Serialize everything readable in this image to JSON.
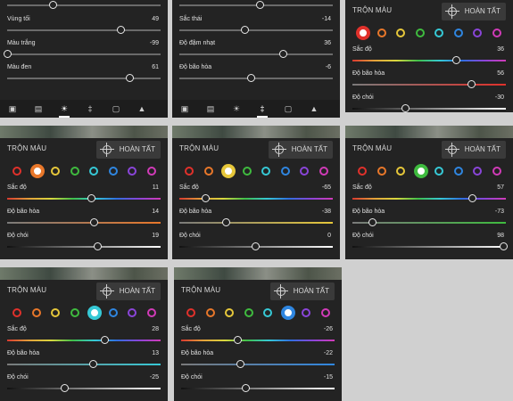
{
  "colors": {
    "red": "#e0312b",
    "orange": "#e8772a",
    "yellow": "#e6c73a",
    "green": "#3fbb3f",
    "aqua": "#36c9d6",
    "blue": "#2f86e0",
    "purple": "#8a45d9",
    "magenta": "#d13bb8",
    "panel_bg": "#232323",
    "page_bg": "#d0d0d0"
  },
  "common": {
    "mix_title": "TRỘN MÀU",
    "done_label": "HOÀN TẤT"
  },
  "panel_light": {
    "rows": [
      {
        "label": "",
        "value": "",
        "pos": 0.3
      },
      {
        "label": "Vùng tối",
        "value": "49",
        "pos": 0.745
      },
      {
        "label": "Màu trắng",
        "value": "-99",
        "pos": 0.005
      },
      {
        "label": "Màu đen",
        "value": "61",
        "pos": 0.805
      }
    ],
    "toolbar": [
      "crop-icon",
      "auto-icon",
      "light-icon",
      "color-icon",
      "vignette-icon",
      "detail-icon"
    ],
    "active_tool": 2
  },
  "panel_color": {
    "rows": [
      {
        "label": "",
        "value": "",
        "pos": 0.53
      },
      {
        "label": "Sắc thái",
        "value": "-14",
        "pos": 0.43
      },
      {
        "label": "Độ đậm nhạt",
        "value": "36",
        "pos": 0.68
      },
      {
        "label": "Độ bão hòa",
        "value": "-6",
        "pos": 0.47
      }
    ],
    "toolbar": [
      "crop-icon",
      "auto-icon",
      "light-icon",
      "color-icon",
      "vignette-icon",
      "detail-icon"
    ],
    "active_tool": 3
  },
  "mixers": [
    {
      "selected": "red",
      "hue": "36",
      "sat": "56",
      "lum": "-30",
      "hue_pos": 0.68,
      "sat_pos": 0.78,
      "lum_pos": 0.35
    },
    {
      "selected": "orange",
      "hue": "11",
      "sat": "14",
      "lum": "19",
      "hue_pos": 0.555,
      "sat_pos": 0.57,
      "lum_pos": 0.595
    },
    {
      "selected": "yellow",
      "hue": "-65",
      "sat": "-38",
      "lum": "0",
      "hue_pos": 0.175,
      "sat_pos": 0.31,
      "lum_pos": 0.5
    },
    {
      "selected": "green",
      "hue": "57",
      "sat": "-73",
      "lum": "98",
      "hue_pos": 0.785,
      "sat_pos": 0.135,
      "lum_pos": 0.99
    },
    {
      "selected": "aqua",
      "hue": "28",
      "sat": "13",
      "lum": "-25",
      "hue_pos": 0.64,
      "sat_pos": 0.565,
      "lum_pos": 0.375
    },
    {
      "selected": "blue",
      "hue": "-26",
      "sat": "-22",
      "lum": "-15",
      "hue_pos": 0.37,
      "sat_pos": 0.39,
      "lum_pos": 0.425
    }
  ],
  "mixer_labels": {
    "hue": "Sắc độ",
    "sat": "Độ bão hòa",
    "lum": "Độ chói"
  },
  "swatch_order": [
    "red",
    "orange",
    "yellow",
    "green",
    "aqua",
    "blue",
    "purple",
    "magenta"
  ]
}
